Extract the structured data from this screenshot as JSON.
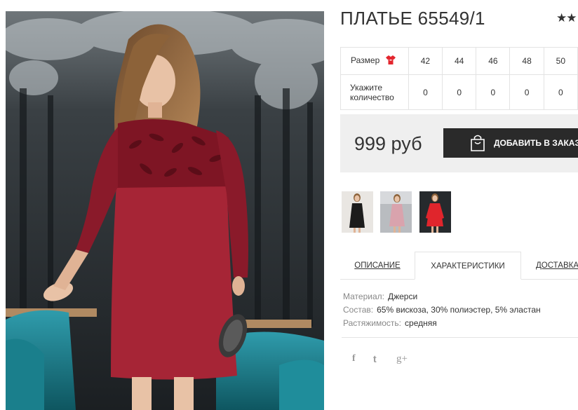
{
  "product": {
    "title": "ПЛАТЬЕ 65549/1",
    "rating_stars": "★★"
  },
  "size_table": {
    "size_label": "Размер",
    "sizes": [
      "42",
      "44",
      "46",
      "48",
      "50"
    ],
    "qty_label_line1": "Укажите",
    "qty_label_line2": "количество",
    "quantities": [
      "0",
      "0",
      "0",
      "0",
      "0"
    ]
  },
  "purchase": {
    "price": "999 руб",
    "add_button_label": "ДОБАВИТЬ В ЗАКАЗ"
  },
  "tabs": [
    {
      "label": "ОПИСАНИЕ",
      "active": false
    },
    {
      "label": "ХАРАКТЕРИСТИКИ",
      "active": true
    },
    {
      "label": "ДОСТАВКА И",
      "active": false
    }
  ],
  "specs": [
    {
      "key": "Материал:",
      "value": "Джерси"
    },
    {
      "key": "Состав:",
      "value": "65% вискоза, 30% полиэстер, 5% эластан"
    },
    {
      "key": "Растяжимость:",
      "value": "средняя"
    }
  ],
  "social": {
    "facebook": "f",
    "twitter": "t",
    "googleplus": "g+"
  },
  "icons": {
    "size_chart": "dress-icon",
    "cart": "shopping-bag-icon",
    "facebook": "facebook-icon",
    "twitter": "twitter-icon",
    "googleplus": "google-plus-icon"
  },
  "colors": {
    "dress_burgundy": "#a62536",
    "button_dark": "#2a2a2a",
    "price_bg": "#efefef",
    "size_icon_red": "#e3262e",
    "thumb_black": "#1c1c1c",
    "thumb_pink": "#d9a3ad",
    "thumb_red": "#e0252c"
  }
}
